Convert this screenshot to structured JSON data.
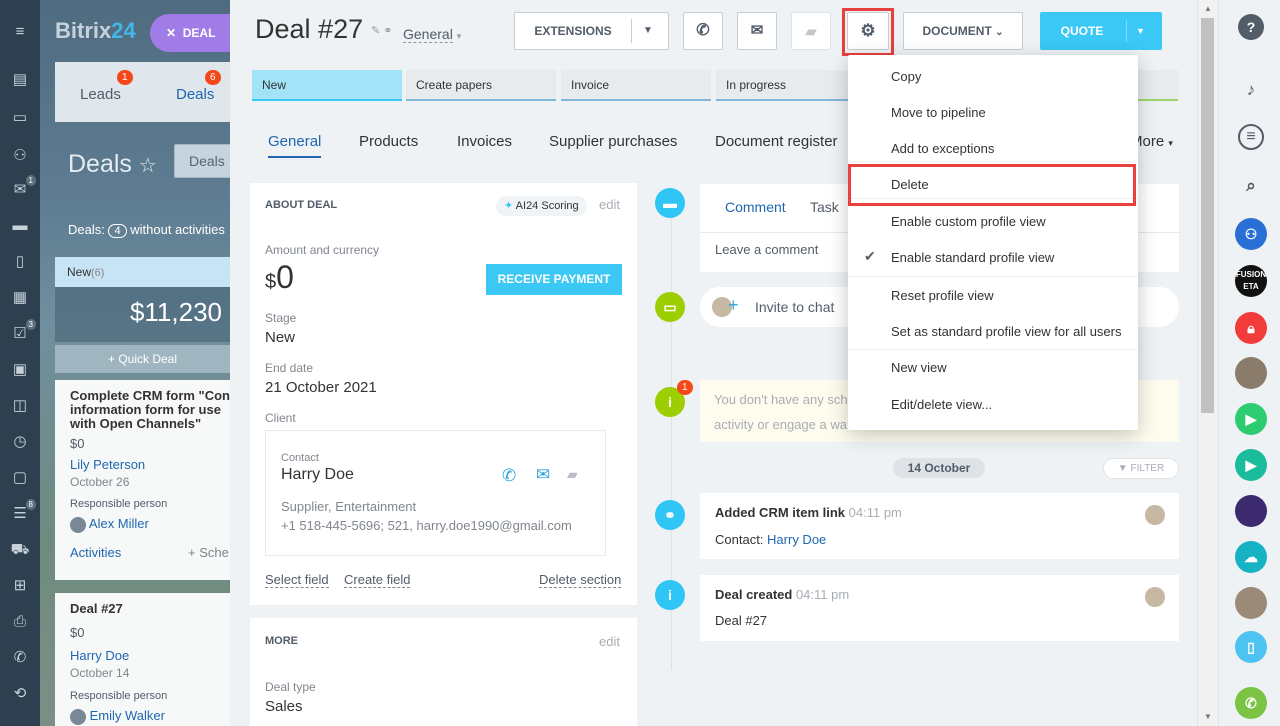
{
  "left_icons": [
    "menu-icon",
    "grid-icon",
    "chat-icon",
    "group-icon",
    "mail-icon",
    "inbox-icon",
    "document-icon",
    "calendar-icon",
    "task-icon",
    "contact-card-icon",
    "feed-icon",
    "clock-icon",
    "window-icon",
    "filter-icon",
    "cart-icon",
    "apps-icon",
    "printer-icon",
    "phone-icon",
    "sync-icon"
  ],
  "left_badges": {
    "mail": "1",
    "task": "3",
    "filter": "8"
  },
  "bg": {
    "logo": "Bitrix",
    "logo_accent": "24",
    "deal_pill": "DEAL",
    "tab_leads": "Leads",
    "tab_leads_badge": "1",
    "tab_deals": "Deals",
    "tab_deals_badge": "6",
    "deals_title": "Deals",
    "deals_btn": "Deals",
    "count_label": "Deals:",
    "count_value": "4",
    "count_suffix": "without activities",
    "column_name": "New",
    "column_count": "(6)",
    "column_sum": "$11,230",
    "quick_deal": "+ Quick Deal",
    "card1": {
      "title": "Complete CRM form \"Con information form for use with Open Channels\"",
      "amount": "$0",
      "client": "Lily Peterson",
      "date": "October 26",
      "resp_label": "Responsible person",
      "resp": "Alex Miller",
      "activities": "Activities",
      "schedule": "+ Sche"
    },
    "card2": {
      "title": "Deal #27",
      "amount": "$0",
      "client": "Harry Doe",
      "date": "October 14",
      "resp_label": "Responsible person",
      "resp": "Emily Walker"
    }
  },
  "header": {
    "title": "Deal",
    "number": "#27",
    "category": "General",
    "extensions": "EXTENSIONS",
    "document": "DOCUMENT",
    "quote": "QUOTE"
  },
  "stages": [
    "New",
    "Create papers",
    "Invoice",
    "In progress"
  ],
  "tabs": [
    "General",
    "Products",
    "Invoices",
    "Supplier purchases",
    "Document register",
    "More"
  ],
  "about": {
    "heading": "ABOUT DEAL",
    "scoring": "AI24 Scoring",
    "edit": "edit",
    "amount_label": "Amount and currency",
    "currency": "$",
    "amount": "0",
    "receive_payment": "RECEIVE PAYMENT",
    "stage_label": "Stage",
    "stage": "New",
    "end_label": "End date",
    "end": "21 October 2021",
    "client_label": "Client",
    "contact_label": "Contact",
    "contact": "Harry Doe",
    "contact_info1": "Supplier, Entertainment",
    "contact_info2": "+1 518-445-5696; 521, harry.doe1990@gmail.com",
    "select_field": "Select field",
    "create_field": "Create field",
    "delete_section": "Delete section"
  },
  "more": {
    "heading": "MORE",
    "edit": "edit",
    "deal_type_label": "Deal type",
    "deal_type": "Sales"
  },
  "timeline": {
    "tab_comment": "Comment",
    "tab_task": "Task",
    "comment_placeholder": "Leave a comment",
    "invite": "Invite to chat",
    "notice_line1": "You don't have any sch",
    "notice_line2": "activity or engage a wa",
    "notice_badge": "1",
    "date_sep": "14 October",
    "filter": "FILTER",
    "item1_title": "Added CRM item link",
    "item1_time": "04:11 pm",
    "item1_label": "Contact:",
    "item1_link": "Harry Doe",
    "item2_title": "Deal created",
    "item2_time": "04:11 pm",
    "item2_text": "Deal #27"
  },
  "menu": {
    "items": [
      "Copy",
      "Move to pipeline",
      "Add to exceptions",
      "Delete",
      "Enable custom profile view",
      "Enable standard profile view",
      "Reset profile view",
      "Set as standard profile view for all users",
      "New view",
      "Edit/delete view..."
    ],
    "checked": "Enable standard profile view",
    "highlighted": "Delete"
  },
  "right_icons": [
    "help-icon",
    "bell-icon",
    "chat-list-icon",
    "search-icon",
    "group-chat-icon",
    "fusion-avatar",
    "lock-icon",
    "user-avatar-1",
    "video-call-icon",
    "video-icon-2",
    "user-avatar-2",
    "cloud-icon",
    "user-avatar-3",
    "mobile-icon",
    "phone-call-icon"
  ],
  "right_fusion_text": "FUSION ETA",
  "colors": {
    "accent": "#3bc8f5",
    "link": "#2067b0",
    "highlight_red": "#e8403c",
    "stage_active": "#a3e3f7"
  }
}
